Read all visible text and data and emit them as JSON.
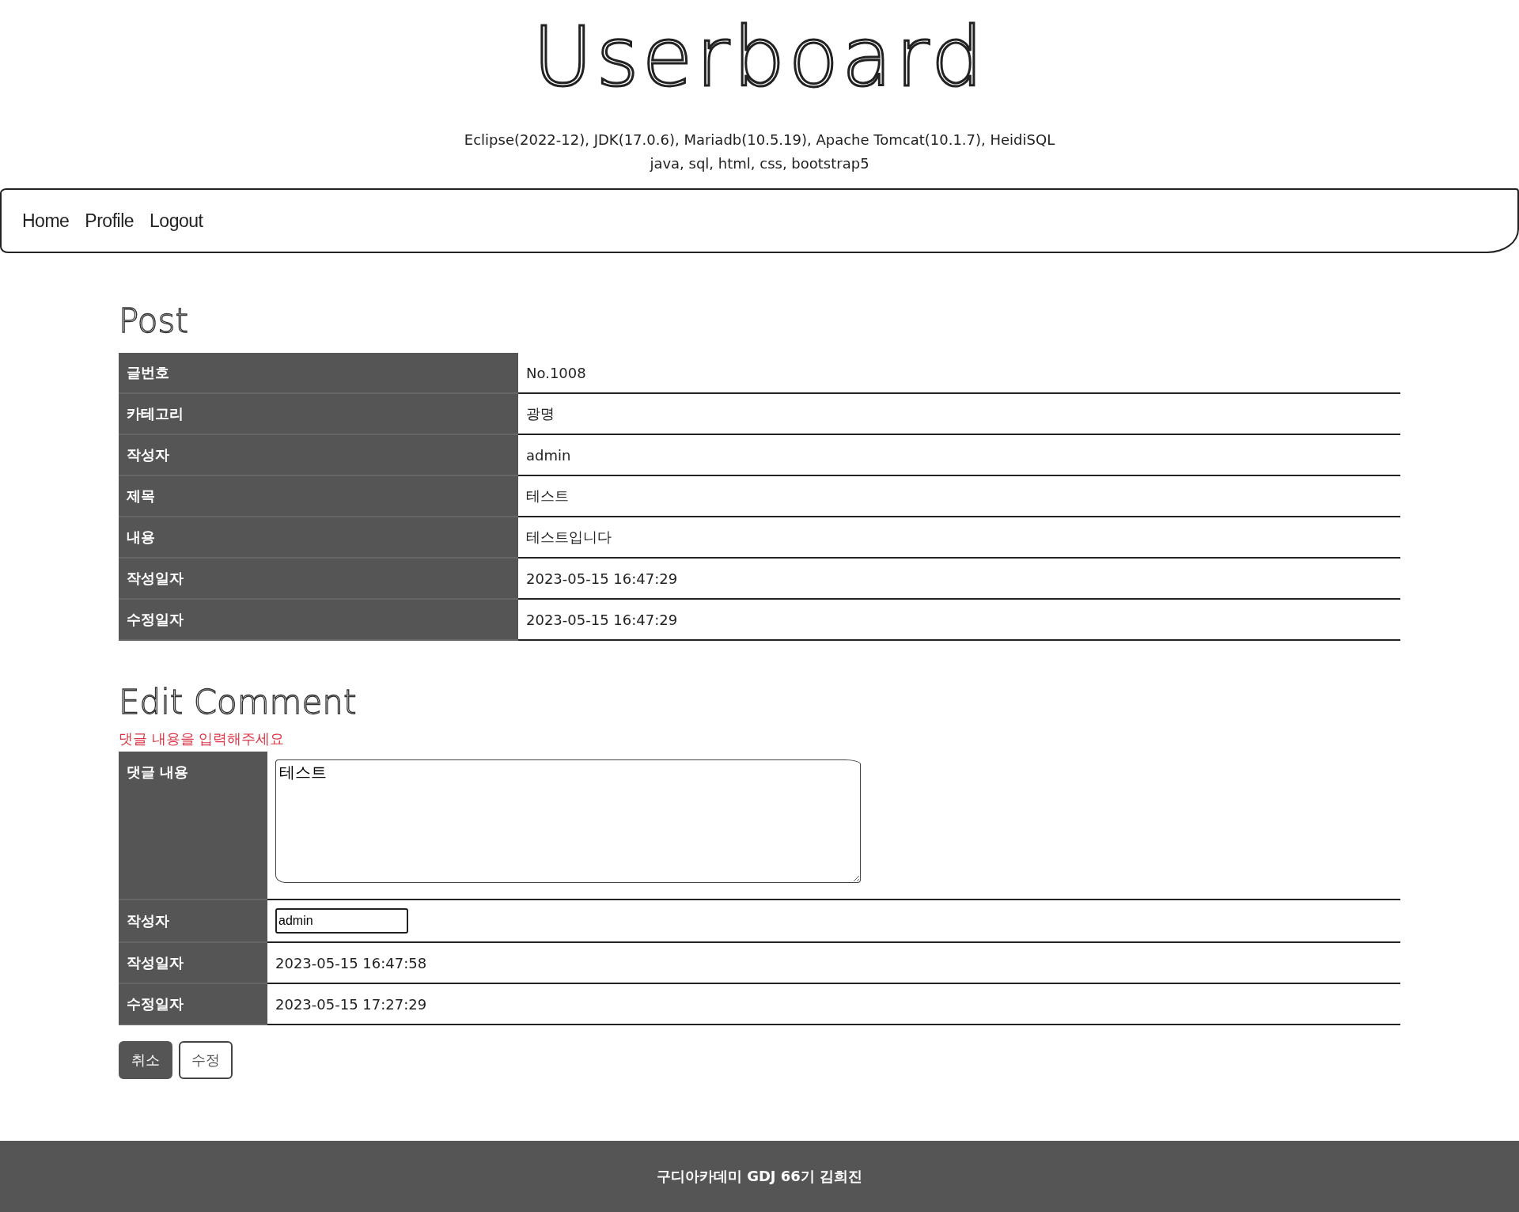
{
  "header": {
    "title": "Userboard",
    "subtitle_lines": [
      "Eclipse(2022-12), JDK(17.0.6), Mariadb(10.5.19), Apache Tomcat(10.1.7), HeidiSQL",
      "java, sql, html, css, bootstrap5"
    ]
  },
  "nav": {
    "links": [
      "Home",
      "Profile",
      "Logout"
    ]
  },
  "post": {
    "heading": "Post",
    "rows": [
      {
        "label": "글번호",
        "value": "No.1008"
      },
      {
        "label": "카테고리",
        "value": "광명"
      },
      {
        "label": "작성자",
        "value": "admin"
      },
      {
        "label": "제목",
        "value": "테스트"
      },
      {
        "label": "내용",
        "value": "테스트입니다"
      },
      {
        "label": "작성일자",
        "value": "2023-05-15 16:47:29"
      },
      {
        "label": "수정일자",
        "value": "2023-05-15 16:47:29"
      }
    ]
  },
  "edit_comment": {
    "heading": "Edit Comment",
    "error": "댓글 내용을 입력해주세요",
    "rows": [
      {
        "kind": "textarea",
        "label": "댓글 내용",
        "value": "테스트"
      },
      {
        "kind": "input",
        "label": "작성자",
        "value": "admin"
      },
      {
        "kind": "text",
        "label": "작성일자",
        "value": "2023-05-15 16:47:58"
      },
      {
        "kind": "text",
        "label": "수정일자",
        "value": "2023-05-15 17:27:29"
      }
    ],
    "buttons": [
      {
        "label": "취소",
        "kind": "dark"
      },
      {
        "label": "수정",
        "kind": "outline"
      }
    ]
  },
  "footer": {
    "text": "구디아카데미 GDJ 66기 김희진"
  }
}
